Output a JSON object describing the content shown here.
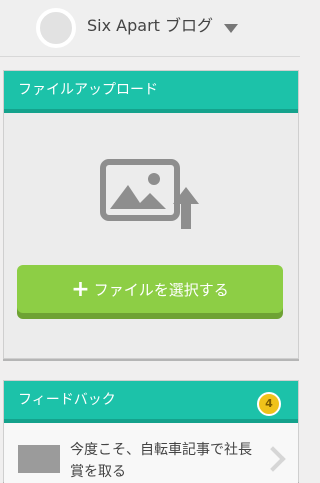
{
  "header": {
    "blog_name": "Six Apart ブログ"
  },
  "upload": {
    "title": "ファイルアップロード",
    "plus": "+",
    "button_label": "ファイルを選択する"
  },
  "feedback": {
    "title": "フィードバック",
    "badge_count": "4",
    "item_title": "今度こそ、自転車記事で社長賞を取る"
  }
}
